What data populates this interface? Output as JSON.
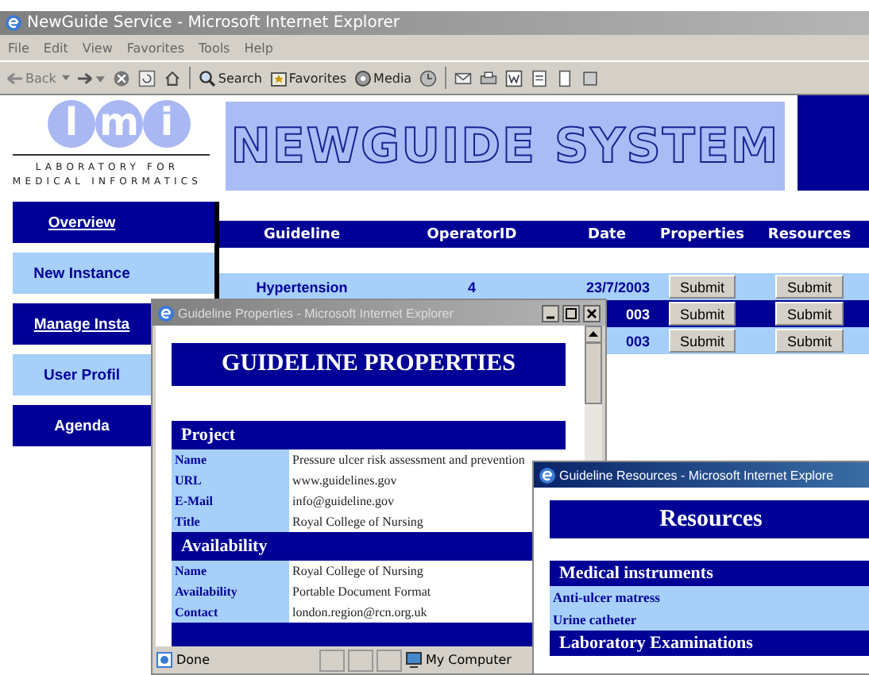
{
  "window": {
    "title": "NewGuide Service - Microsoft Internet Explorer",
    "active": false
  },
  "menu": [
    "File",
    "Edit",
    "View",
    "Favorites",
    "Tools",
    "Help"
  ],
  "toolbar": {
    "back": "Back",
    "search": "Search",
    "favorites": "Favorites",
    "media": "Media"
  },
  "logo": {
    "letters": [
      "l",
      "m",
      "i"
    ],
    "line_1": "LABORATORY FOR",
    "line_2": "MEDICAL INFORMATICS"
  },
  "banner": "NEWGUIDE SYSTEM",
  "nav": [
    {
      "label": "Overview",
      "kind": "link"
    },
    {
      "label": "New Instance",
      "kind": "label"
    },
    {
      "label": "Manage Insta",
      "kind": "link"
    },
    {
      "label": "User Profil",
      "kind": "label"
    },
    {
      "label": "Agenda",
      "kind": "label"
    }
  ],
  "table": {
    "columns": [
      "Guideline",
      "OperatorID",
      "Date",
      "Properties",
      "Resources"
    ],
    "rows": [
      {
        "guideline": "Hypertension",
        "operator": "4",
        "date": "23/7/2003",
        "properties": "Submit",
        "resources": "Submit"
      },
      {
        "date": "003",
        "properties": "Submit",
        "resources": "Submit"
      },
      {
        "date": "003",
        "properties": "Submit",
        "resources": "Submit"
      }
    ]
  },
  "properties_window": {
    "title": "Guideline Properties - Microsoft Internet Explorer",
    "active": false,
    "heading": "GUIDELINE PROPERTIES",
    "sections": [
      {
        "title": "Project",
        "rows": [
          {
            "label": "Name",
            "value": "Pressure ulcer risk assessment and  prevention"
          },
          {
            "label": "URL",
            "value": "www.guidelines.gov"
          },
          {
            "label": "E-Mail",
            "value": "info@guideline.gov"
          },
          {
            "label": "Title",
            "value": "Royal College of Nursing"
          }
        ]
      },
      {
        "title": "Availability",
        "rows": [
          {
            "label": "Name",
            "value": "Royal College of Nursing"
          },
          {
            "label": "Availability",
            "value": "Portable Document Format"
          },
          {
            "label": "Contact",
            "value": "london.region@rcn.org.uk"
          }
        ]
      }
    ],
    "status": "Done",
    "zone": "My Computer"
  },
  "resources_window": {
    "title": "Guideline Resources - Microsoft Internet Explore",
    "active": true,
    "heading": "Resources",
    "sections": [
      {
        "title": "Medical instruments",
        "items": [
          "Anti-ulcer matress",
          "Urine catheter"
        ]
      },
      {
        "title": "Laboratory Examinations"
      }
    ]
  }
}
